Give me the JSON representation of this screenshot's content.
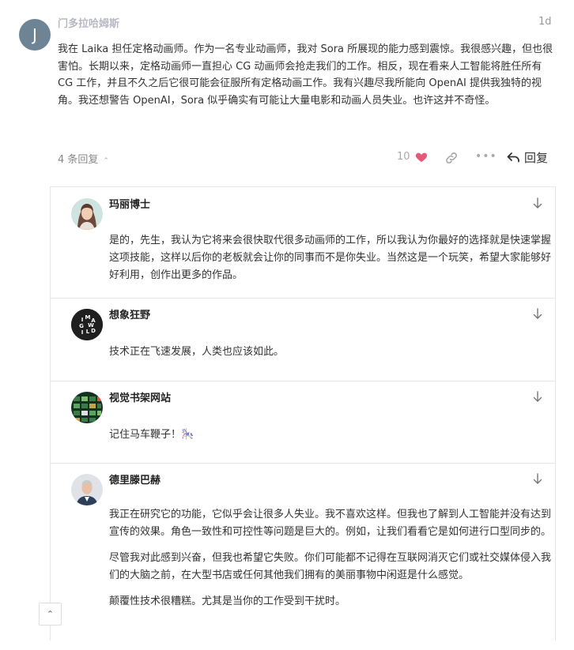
{
  "post": {
    "avatar_letter": "J",
    "author": "门多拉哈姆斯",
    "age": "1d",
    "body": "我在 Laika 担任定格动画师。作为一名专业动画师，我对 Sora 所展现的能力感到震惊。我很感兴趣，但也很害怕。长期以来，定格动画师一直担心 CG 动画师会抢走我们的工作。相反，现在看来人工智能将胜任所有 CG 工作，并且不久之后它很可能会征服所有定格动画工作。我有兴趣尽我所能向 OpenAI 提供我独特的视角。我还想警告 OpenAI，Sora 似乎确实有可能让大量电影和动画人员失业。也许这并不奇怪。",
    "replies_toggle": "4 条回复",
    "like_count": "10",
    "reply_label": "回复",
    "colors": {
      "heart": "#e45a78",
      "avatar": "#6e8494"
    }
  },
  "replies": [
    {
      "author": "玛丽博士",
      "avatar_icon": "woman-portrait",
      "paragraphs": [
        "是的，先生，我认为它将来会很快取代很多动画师的工作，所以我认为你最好的选择就是快速掌握这项技能，这样以后你的老板就会让你的同事而不是你失业。当然这是一个玩笑，希望大家能够好好利用，创作出更多的作品。"
      ]
    },
    {
      "author": "想象狂野",
      "avatar_icon": "imagine-wild-logo",
      "avatar_letters": [
        "I",
        "M",
        "A",
        "G",
        "W",
        "I",
        "L",
        "D"
      ],
      "paragraphs": [
        "技术正在飞速发展，人类也应该如此。"
      ]
    },
    {
      "author": "视觉书架网站",
      "avatar_icon": "bookshelf-grid",
      "paragraphs": [
        "记住马车鞭子！🎠"
      ]
    },
    {
      "author": "德里滕巴赫",
      "avatar_icon": "man-portrait",
      "paragraphs": [
        "我正在研究它的功能，它似乎会让很多人失业。我不喜欢这样。但我也了解到人工智能并没有达到宣传的效果。角色一致性和可控性等问题是巨大的。例如，让我们看看它是如何进行口型同步的。",
        "尽管我对此感到兴奋，但我也希望它失败。你们可能都不记得在互联网消灭它们或社交媒体侵入我们的大脑之前，在大型书店或任何其他我们拥有的美丽事物中闲逛是什么感觉。",
        "颠覆性技术很糟糕。尤其是当你的工作受到干扰时。"
      ]
    }
  ]
}
